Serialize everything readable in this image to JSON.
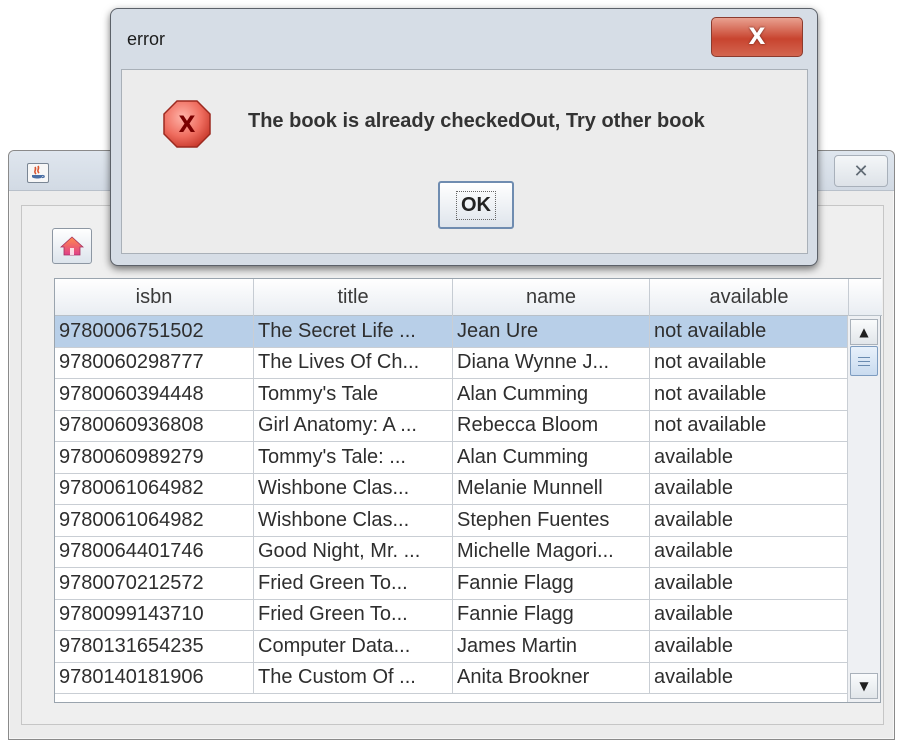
{
  "main_window": {
    "close_glyph": "✕",
    "home_icon": "home-icon"
  },
  "table": {
    "columns": [
      "isbn",
      "title",
      "name",
      "available"
    ],
    "rows": [
      {
        "isbn": "9780006751502",
        "title": "The Secret Life ...",
        "name": "Jean Ure",
        "available": "not available",
        "selected": true
      },
      {
        "isbn": "9780060298777",
        "title": "The Lives Of Ch...",
        "name": "Diana Wynne J...",
        "available": "not available"
      },
      {
        "isbn": "9780060394448",
        "title": "Tommy's Tale",
        "name": "Alan Cumming",
        "available": "not available"
      },
      {
        "isbn": "9780060936808",
        "title": "Girl Anatomy: A ...",
        "name": "Rebecca Bloom",
        "available": "not available"
      },
      {
        "isbn": "9780060989279",
        "title": "Tommy's Tale: ...",
        "name": "Alan Cumming",
        "available": "available"
      },
      {
        "isbn": "9780061064982",
        "title": "Wishbone Clas...",
        "name": "Melanie Munnell",
        "available": "available"
      },
      {
        "isbn": "9780061064982",
        "title": "Wishbone Clas...",
        "name": "Stephen Fuentes",
        "available": "available"
      },
      {
        "isbn": "9780064401746",
        "title": "Good Night, Mr. ...",
        "name": "Michelle Magori...",
        "available": "available"
      },
      {
        "isbn": "9780070212572",
        "title": "Fried Green To...",
        "name": "Fannie Flagg",
        "available": "available"
      },
      {
        "isbn": "9780099143710",
        "title": "Fried Green To...",
        "name": "Fannie Flagg",
        "available": "available"
      },
      {
        "isbn": "9780131654235",
        "title": "Computer Data...",
        "name": "James Martin",
        "available": "available"
      },
      {
        "isbn": "9780140181906",
        "title": "The Custom Of ...",
        "name": "Anita Brookner",
        "available": "available"
      }
    ]
  },
  "dialog": {
    "title": "error",
    "close_glyph": "X",
    "message": "The book is already checkedOut, Try other book",
    "ok_label": "OK",
    "icon": "error-icon"
  },
  "colors": {
    "selection": "#b8cfe8",
    "dialog_close": "#c8442f",
    "error_icon": "#d9534f"
  }
}
